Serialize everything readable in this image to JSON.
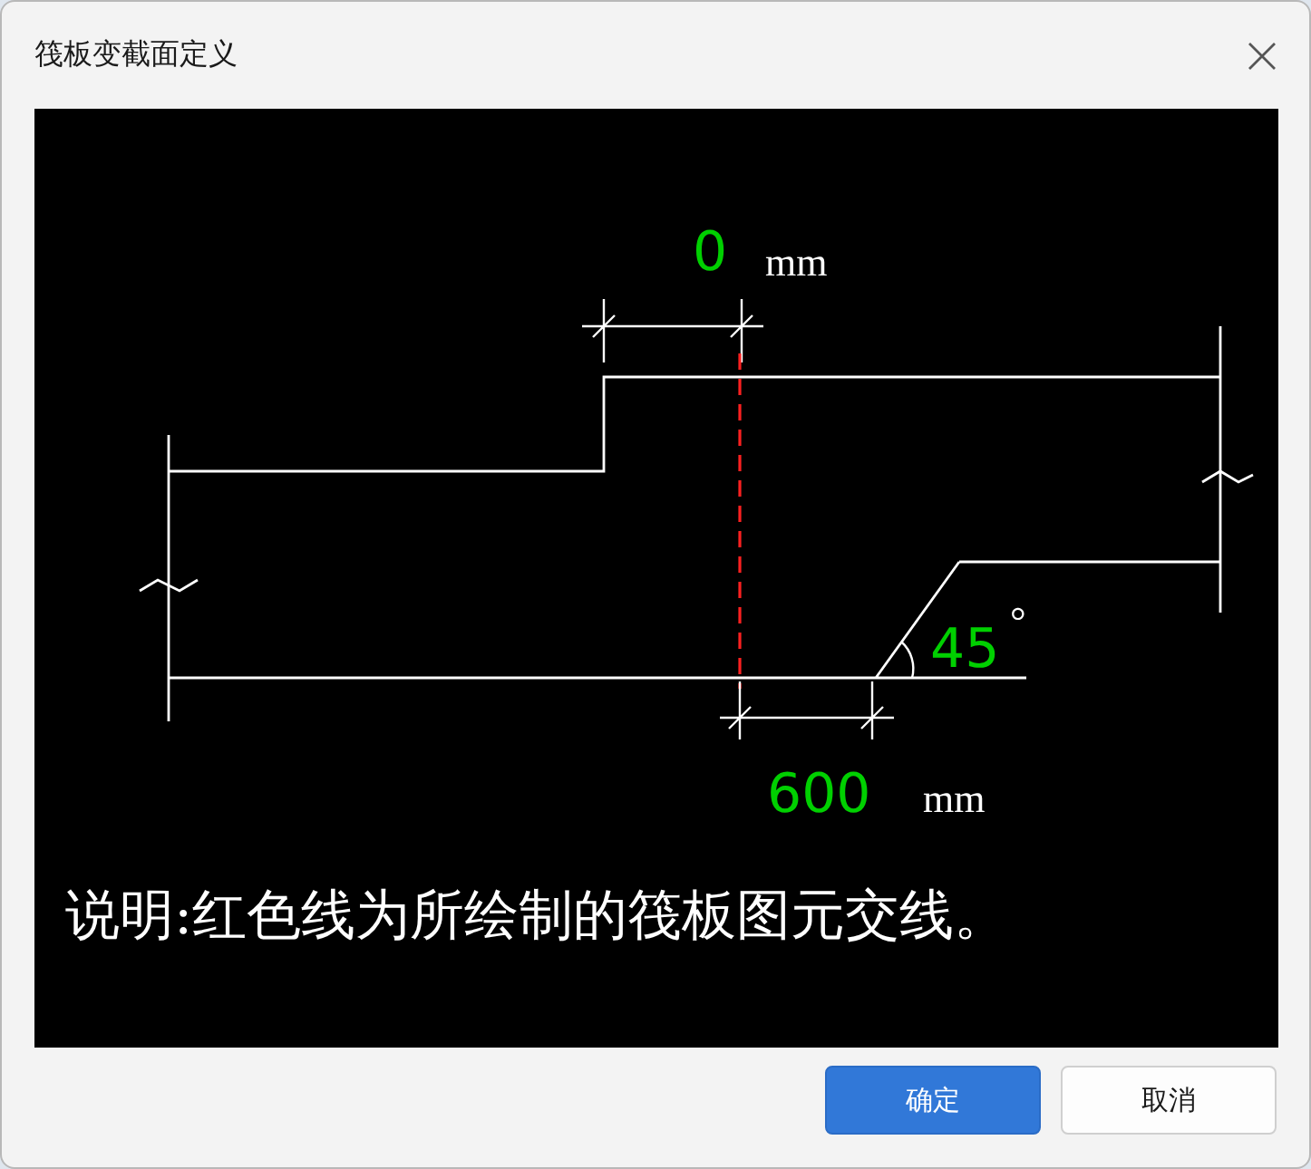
{
  "window": {
    "title": "筏板变截面定义"
  },
  "drawing": {
    "top_offset": {
      "value": "0",
      "unit": "mm"
    },
    "bottom_width": {
      "value": "600",
      "unit": "mm"
    },
    "angle": {
      "value": "45",
      "unit": "°"
    },
    "note": "说明:红色线为所绘制的筏板图元交线。"
  },
  "buttons": [
    {
      "label": "确定",
      "kind": "primary"
    },
    {
      "label": "取消",
      "kind": "secondary"
    }
  ]
}
